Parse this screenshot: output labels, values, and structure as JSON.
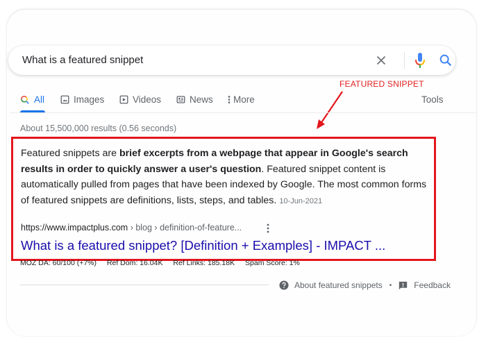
{
  "search": {
    "query": "What is a featured snippet",
    "clear_icon": "close-icon",
    "mic_icon": "microphone-icon",
    "search_icon": "search-icon"
  },
  "tabs": [
    {
      "label": "All",
      "icon": "search-icon",
      "active": true
    },
    {
      "label": "Images",
      "icon": "image-icon",
      "active": false
    },
    {
      "label": "Videos",
      "icon": "play-icon",
      "active": false
    },
    {
      "label": "News",
      "icon": "newspaper-icon",
      "active": false
    },
    {
      "label": "More",
      "icon": "more-vert-icon",
      "active": false
    }
  ],
  "tools_label": "Tools",
  "annotation": {
    "label": "FEATURED SNIPPET",
    "color": "#e3161c"
  },
  "result_stats": "About 15,500,000 results (0.56 seconds)",
  "snippet": {
    "lead": "Featured snippets are ",
    "bold": "brief excerpts from a webpage that appear in Google's search results in order to quickly answer a user's question",
    "rest": ". Featured snippet content is automatically pulled from pages that have been indexed by Google. The most common forms of featured snippets are definitions, lists, steps, and tables.",
    "date": "10-Jun-2021",
    "cite_domain": "https://www.impactplus.com",
    "cite_path": " › blog › definition-of-feature...",
    "title": "What is a featured snippet? [Definition + Examples] - IMPACT ..."
  },
  "moz": {
    "da": "MOZ DA: 60/100 (+7%)",
    "ref_dom": "Ref Dom: 16.04K",
    "ref_links": "Ref Links: 185.18K",
    "spam": "Spam Score: 1%"
  },
  "footer": {
    "about_label": "About featured snippets",
    "separator": "•",
    "feedback_label": "Feedback"
  },
  "colors": {
    "accent": "#1a73e8",
    "link": "#1a0dab",
    "annotation": "#e3161c"
  }
}
